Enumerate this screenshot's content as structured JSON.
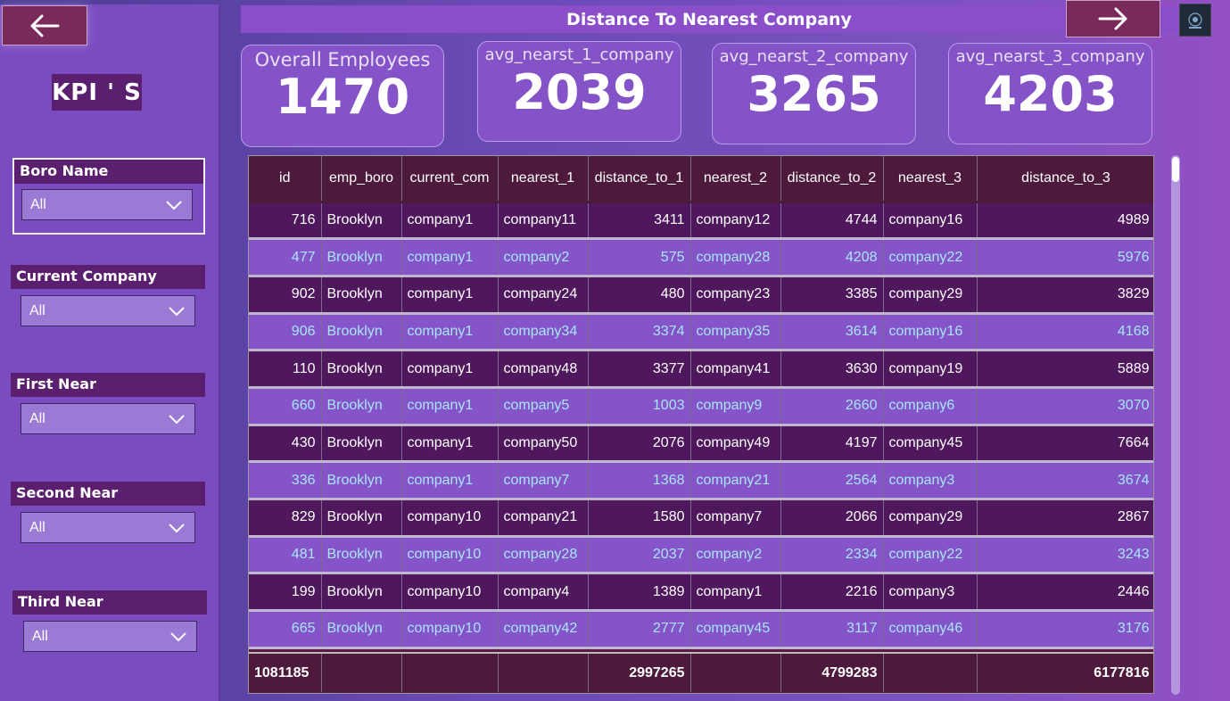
{
  "nav": {
    "back_icon": "arrow-left-icon",
    "next_icon": "arrow-right-icon"
  },
  "header": {
    "title": "Distance To Nearest Company"
  },
  "sidebar": {
    "kpi_title": "KPI ' S",
    "slicers": [
      {
        "label": "Boro Name",
        "value": "All"
      },
      {
        "label": "Current Company",
        "value": "All"
      },
      {
        "label": "First Near",
        "value": "All"
      },
      {
        "label": "Second  Near",
        "value": "All"
      },
      {
        "label": "Third  Near",
        "value": "All"
      }
    ]
  },
  "kpis": [
    {
      "label": "Overall Employees",
      "value": "1470"
    },
    {
      "label": "avg_nearst_1_company",
      "value": "2039"
    },
    {
      "label": "avg_nearst_2_company",
      "value": "3265"
    },
    {
      "label": "avg_nearst_3_company",
      "value": "4203"
    }
  ],
  "table": {
    "columns": [
      "id",
      "emp_boro",
      "current_com",
      "nearest_1",
      "distance_to_1",
      "nearest_2",
      "distance_to_2",
      "nearest_3",
      "distance_to_3"
    ],
    "rows": [
      [
        "716",
        "Brooklyn",
        "company1",
        "company11",
        "3411",
        "company12",
        "4744",
        "company16",
        "4989"
      ],
      [
        "477",
        "Brooklyn",
        "company1",
        "company2",
        "575",
        "company28",
        "4208",
        "company22",
        "5976"
      ],
      [
        "902",
        "Brooklyn",
        "company1",
        "company24",
        "480",
        "company23",
        "3385",
        "company29",
        "3829"
      ],
      [
        "906",
        "Brooklyn",
        "company1",
        "company34",
        "3374",
        "company35",
        "3614",
        "company16",
        "4168"
      ],
      [
        "110",
        "Brooklyn",
        "company1",
        "company48",
        "3377",
        "company41",
        "3630",
        "company19",
        "5889"
      ],
      [
        "660",
        "Brooklyn",
        "company1",
        "company5",
        "1003",
        "company9",
        "2660",
        "company6",
        "3070"
      ],
      [
        "430",
        "Brooklyn",
        "company1",
        "company50",
        "2076",
        "company49",
        "4197",
        "company45",
        "7664"
      ],
      [
        "336",
        "Brooklyn",
        "company1",
        "company7",
        "1368",
        "company21",
        "2564",
        "company3",
        "3674"
      ],
      [
        "829",
        "Brooklyn",
        "company10",
        "company21",
        "1580",
        "company7",
        "2066",
        "company29",
        "2867"
      ],
      [
        "481",
        "Brooklyn",
        "company10",
        "company28",
        "2037",
        "company2",
        "2334",
        "company22",
        "3243"
      ],
      [
        "199",
        "Brooklyn",
        "company10",
        "company4",
        "1389",
        "company1",
        "2216",
        "company3",
        "2446"
      ],
      [
        "665",
        "Brooklyn",
        "company10",
        "company42",
        "2777",
        "company45",
        "3117",
        "company46",
        "3176"
      ]
    ],
    "totals": [
      "1081185",
      "",
      "",
      "",
      "2997265",
      "",
      "4799283",
      "",
      "6177816"
    ]
  },
  "colors": {
    "accent": "#7a2a5a",
    "header": "#4e1a3c",
    "row_dark": "#4f185d",
    "row_light": "#8454c8",
    "row_light_text": "#a8e6f8"
  }
}
